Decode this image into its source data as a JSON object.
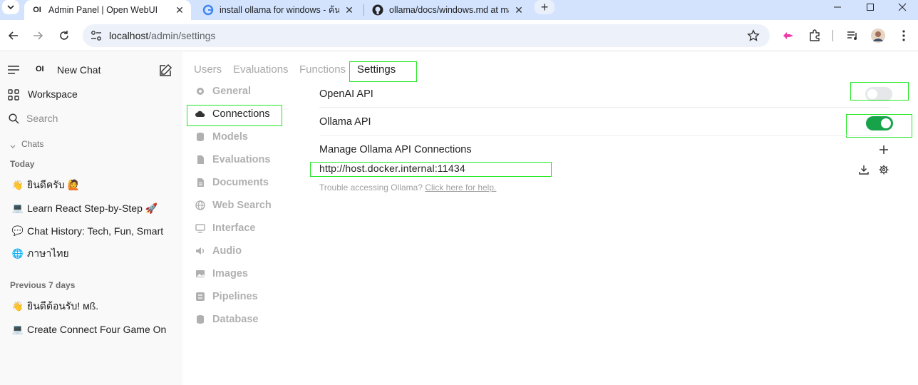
{
  "browser": {
    "tabs": [
      {
        "title": "Admin Panel | Open WebUI",
        "favicon": "openwebui-icon",
        "active": true
      },
      {
        "title": "install ollama for windows - ค้นห",
        "favicon": "google-icon",
        "active": false
      },
      {
        "title": "ollama/docs/windows.md at ma",
        "favicon": "github-icon",
        "active": false
      }
    ],
    "url_host": "localhost",
    "url_path": "/admin/settings"
  },
  "sidebar": {
    "logo_text": "OI",
    "new_chat": "New Chat",
    "workspace": "Workspace",
    "search_placeholder": "Search",
    "chats_header": "Chats",
    "today_label": "Today",
    "today_chats": [
      {
        "emoji": "👋",
        "title": "ยินดีครับ 🙋"
      },
      {
        "emoji": "💻",
        "title": "Learn React Step-by-Step 🚀"
      },
      {
        "emoji": "💬",
        "title": "Chat History: Tech, Fun, Smart"
      },
      {
        "emoji": "🌐",
        "title": "ภาษาไทย"
      }
    ],
    "previous_label": "Previous 7 days",
    "previous_chats": [
      {
        "emoji": "👋",
        "title": "ยินดีต้อนรับ! мß."
      },
      {
        "emoji": "💻",
        "title": "Create Connect Four Game On"
      }
    ]
  },
  "admin_tabs": [
    "Users",
    "Evaluations",
    "Functions",
    "Settings"
  ],
  "settings_nav": [
    {
      "label": "General",
      "icon": "gear-icon"
    },
    {
      "label": "Connections",
      "icon": "cloud-icon"
    },
    {
      "label": "Models",
      "icon": "database-icon"
    },
    {
      "label": "Evaluations",
      "icon": "document-icon"
    },
    {
      "label": "Documents",
      "icon": "file-icon"
    },
    {
      "label": "Web Search",
      "icon": "globe-icon"
    },
    {
      "label": "Interface",
      "icon": "monitor-icon"
    },
    {
      "label": "Audio",
      "icon": "speaker-icon"
    },
    {
      "label": "Images",
      "icon": "image-icon"
    },
    {
      "label": "Pipelines",
      "icon": "pipeline-icon"
    },
    {
      "label": "Database",
      "icon": "database-icon"
    }
  ],
  "connections": {
    "openai_label": "OpenAI API",
    "openai_enabled": false,
    "ollama_label": "Ollama API",
    "ollama_enabled": true,
    "manage_label": "Manage Ollama API Connections",
    "ollama_url": "http://host.docker.internal:11434",
    "help_text": "Trouble accessing Ollama?",
    "help_link": "Click here for help."
  },
  "colors": {
    "toggle_on": "#16a34a",
    "toggle_off": "#e5e7eb",
    "highlight_box": "#22e822",
    "browser_tab_bar": "#d3e3fd"
  }
}
